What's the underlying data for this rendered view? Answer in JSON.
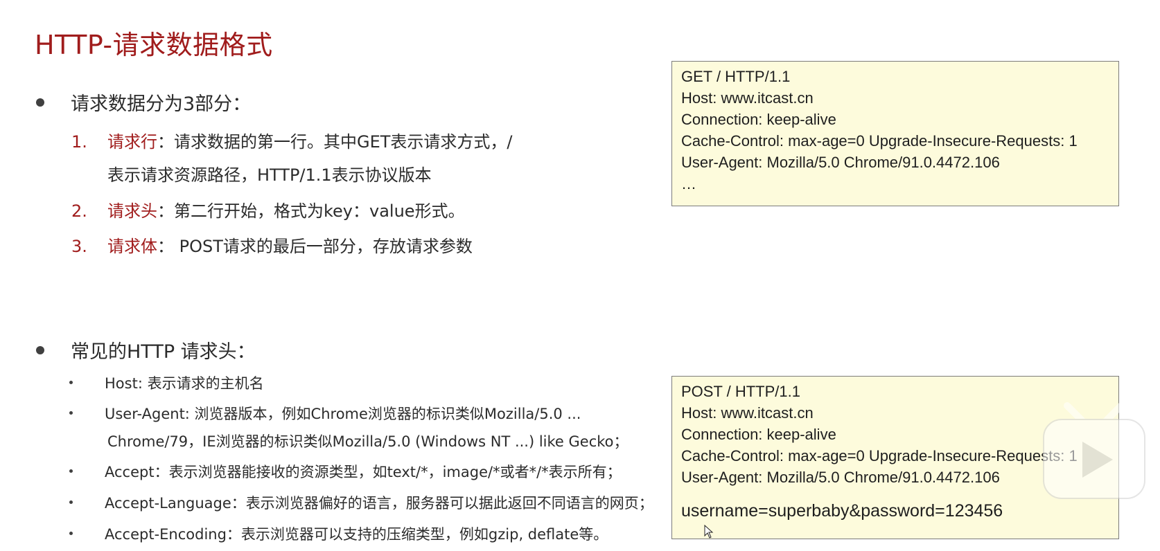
{
  "title": "HTTP-请求数据格式",
  "section1": {
    "heading": "请求数据分为3部分：",
    "items": [
      {
        "num": "1.",
        "term": "请求行",
        "line1": "：请求数据的第一行。其中GET表示请求方式，/",
        "line2": "表示请求资源路径，HTTP/1.1表示协议版本"
      },
      {
        "num": "2.",
        "term": "请求头",
        "line1": "：第二行开始，格式为key：value形式。"
      },
      {
        "num": "3.",
        "term": "请求体",
        "line1": "：  POST请求的最后一部分，存放请求参数"
      }
    ]
  },
  "section2": {
    "heading": "常见的HTTP 请求头：",
    "items": [
      {
        "line1": "Host: 表示请求的主机名"
      },
      {
        "line1": "User-Agent: 浏览器版本，例如Chrome浏览器的标识类似Mozilla/5.0 ...",
        "line2": "Chrome/79，IE浏览器的标识类似Mozilla/5.0 (Windows NT ...) like Gecko；"
      },
      {
        "line1": "Accept：表示浏览器能接收的资源类型，如text/*，image/*或者*/*表示所有；"
      },
      {
        "line1": "Accept-Language：表示浏览器偏好的语言，服务器可以据此返回不同语言的网页；"
      },
      {
        "line1": "Accept-Encoding：表示浏览器可以支持的压缩类型，例如gzip, deflate等。"
      }
    ]
  },
  "get_box": {
    "lines": [
      "GET / HTTP/1.1",
      "Host: www.itcast.cn",
      "Connection: keep-alive",
      "Cache-Control: max-age=0 Upgrade-Insecure-Requests: 1",
      "User-Agent: Mozilla/5.0 Chrome/91.0.4472.106",
      "…"
    ]
  },
  "post_box": {
    "lines": [
      "POST / HTTP/1.1",
      "Host: www.itcast.cn",
      "Connection: keep-alive",
      "Cache-Control: max-age=0 Upgrade-Insecure-Requests: 1",
      "User-Agent: Mozilla/5.0 Chrome/91.0.4472.106"
    ],
    "body": "username=superbaby&password=123456"
  },
  "colors": {
    "accent": "#a01c1c",
    "code_bg": "#fdfbdc"
  },
  "icons": [
    "video-play-overlay-icon",
    "mouse-cursor-icon"
  ]
}
